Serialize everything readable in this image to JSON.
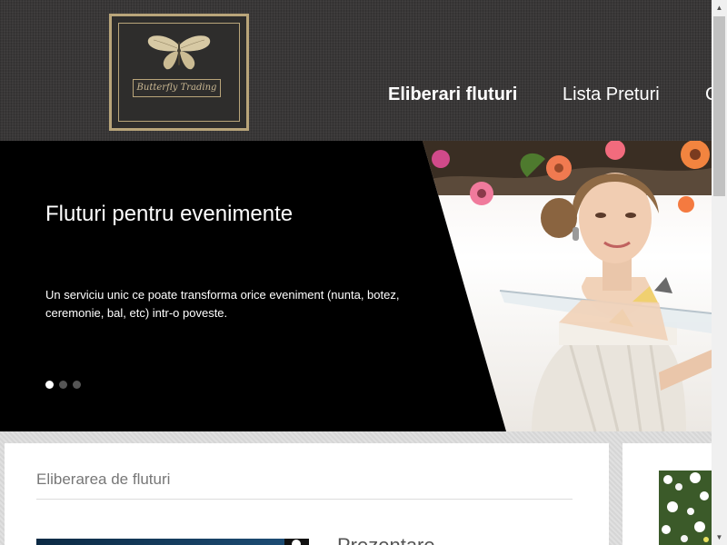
{
  "logo": {
    "text": "Butterfly Trading"
  },
  "nav": {
    "items": [
      {
        "label": "Eliberari fluturi",
        "active": true
      },
      {
        "label": "Lista Preturi",
        "active": false
      },
      {
        "label": "C",
        "active": false
      }
    ]
  },
  "slider": {
    "title": "Fluturi pentru evenimente",
    "description": "Un serviciu unic ce poate transforma orice eveniment (nunta, botez, ceremonie, bal, etc) intr-o poveste.",
    "slide_count": 3,
    "active_slide": 1
  },
  "main": {
    "section_title": "Eliberarea de fluturi",
    "subheading": "Prezentare"
  },
  "colors": {
    "header_bg": "#3a3838",
    "logo_gold": "#b9a57a",
    "slider_bg": "#000000",
    "nav_text": "#ffffff"
  }
}
